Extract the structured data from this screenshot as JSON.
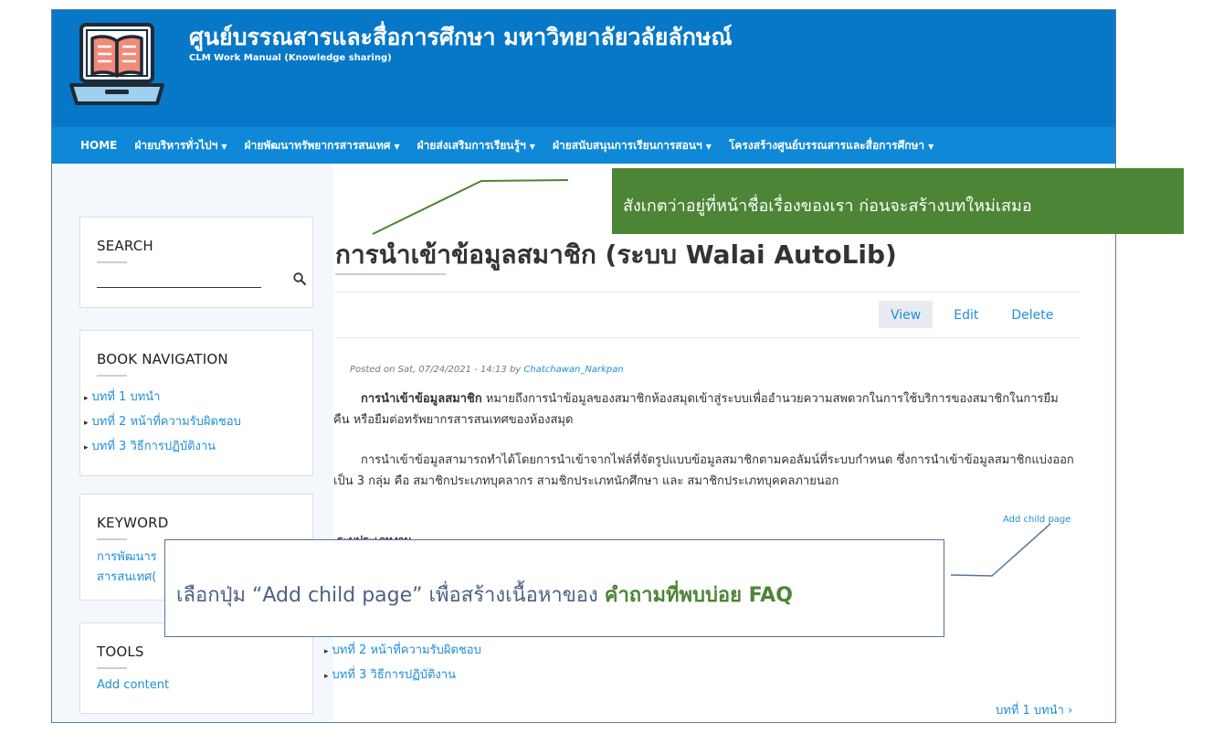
{
  "header": {
    "site_name": "ศูนย์บรรณสารและสื่อการศึกษา มหาวิทยาลัยวลัยลักษณ์",
    "slogan": "CLM Work Manual (Knowledge sharing)",
    "logo_icon": "open-book-laptop-icon"
  },
  "nav": {
    "items": [
      {
        "label": "HOME",
        "dropdown": false
      },
      {
        "label": "ฝ่ายบริหารทั่วไปฯ",
        "dropdown": true
      },
      {
        "label": "ฝ่ายพัฒนาทรัพยากรสารสนเทศ",
        "dropdown": true
      },
      {
        "label": "ฝ่ายส่งเสริมการเรียนรู้ฯ",
        "dropdown": true
      },
      {
        "label": "ฝ่ายสนับสนุนการเรียนการสอนฯ",
        "dropdown": true
      },
      {
        "label": "โครงสร้างศูนย์บรรณสารและสื่อการศึกษา",
        "dropdown": true
      }
    ]
  },
  "sidebar": {
    "search": {
      "title": "SEARCH",
      "placeholder": ""
    },
    "book_navigation": {
      "title": "BOOK NAVIGATION",
      "links": [
        "บทที่ 1 บทนำ",
        "บทที่ 2 หน้าที่ความรับผิดชอบ",
        "บทที่ 3 วิธีการปฏิบัติงาน"
      ]
    },
    "keyword": {
      "title": "KEYWORD",
      "line1": "การพัฒนาร",
      "line2": "สารสนเทศ("
    },
    "tools": {
      "title": "TOOLS",
      "add_content": "Add content"
    }
  },
  "main": {
    "title": "การนำเข้าข้อมูลสมาชิก (ระบบ Walai AutoLib)",
    "tabs": [
      "View",
      "Edit",
      "Delete"
    ],
    "active_tab": "View",
    "submitted_prefix": "Posted on Sat, 07/24/2021 - 14:13 by ",
    "author": "Chatchawan_Narkpan",
    "para1_bold": "การนำเข้าข้อมูลสมาชิก",
    "para1_rest": " หมายถึงการนำข้อมูลของสมาชิกห้องสมุดเข้าสู่ระบบเพื่ออำนวยความสพดวกในการใช้บริการของสมาชิกในการยืม คืน หรือยืมต่อทรัพยากรสารสนเทศของห้องสมุด",
    "para2": "การนำเข้าข้อมูลสามารถทำได้โดยการนำเข้าจากไฟล์ที่จัดรูปแบบข้อมูลสมาชิกตามคอลัมน์ที่ระบบกำหนด ซึ่งการนำเข้าข้อมูลสมาชิกแบ่งออกเป็น 3 กลุ่ม คือ สมาชิกประเภทบุคลากร สามชิกประเภทนักศึกษา และ สมาชิกประเภทบุคคลภายนอก",
    "add_child_page": "Add child page",
    "field_label": "ระบุประเภทงาน",
    "sub_links": [
      "บทที่ 2 หน้าที่ความรับผิดชอบ",
      "บทที่ 3 วิธีการปฏิบัติงาน"
    ],
    "next_link": "บทที่ 1 บทนำ ›"
  },
  "callouts": {
    "top": "สังเกตว่าอยู่ที่หน้าชื่อเรื่องของเรา ก่อนจะสร้างบทใหม่เสมอ",
    "bottom_prefix": "เลือกปุ่ม “Add child page” เพื่อสร้างเนื้อหาของ ",
    "bottom_highlight": "คำถามที่พบบ่อย FAQ"
  },
  "colors": {
    "header_bg": "#0778c8",
    "nav_bg": "#0f88d8",
    "link": "#1f8fd8",
    "callout_green": "#4c8535",
    "callout_border": "#56729a"
  }
}
